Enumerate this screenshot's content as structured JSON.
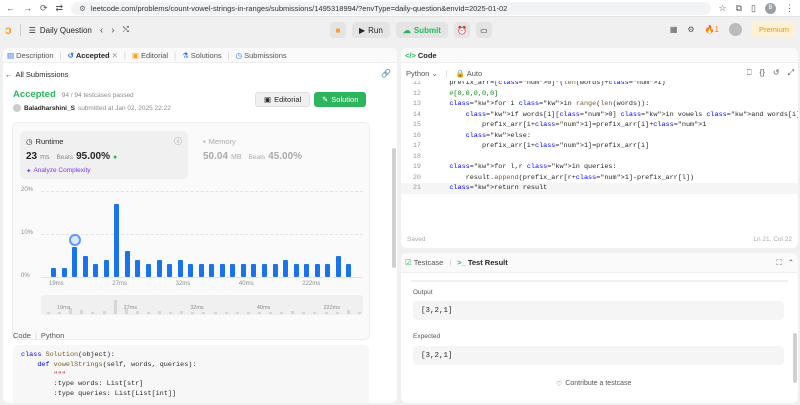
{
  "browser": {
    "url": "leetcode.com/problems/count-vowel-strings-in-ranges/submissions/1495318994/?envType=daily-question&envId=2025-01-02",
    "profile": "B"
  },
  "topbar": {
    "daily_label": "Daily Question",
    "run_label": "Run",
    "submit_label": "Submit",
    "streak": "1",
    "premium_label": "Premium"
  },
  "left_tabs": [
    {
      "label": "Description"
    },
    {
      "label": "Accepted"
    },
    {
      "label": "Editorial"
    },
    {
      "label": "Solutions"
    },
    {
      "label": "Submissions"
    }
  ],
  "submission": {
    "back_label": "All Submissions",
    "status": "Accepted",
    "testcases": "94 / 94 testcases passed",
    "user": "Baladharshini_S",
    "submitted": "submitted at Jan 02, 2025 22:22",
    "editorial_label": "Editorial",
    "solution_label": "Solution",
    "runtime_label": "Runtime",
    "runtime_value": "23",
    "runtime_unit": "ms",
    "beats_label": "Beats",
    "runtime_beats": "95.00%",
    "analyze_label": "Analyze Complexity",
    "memory_label": "Memory",
    "memory_value": "50.04",
    "memory_unit": "MB",
    "memory_beats": "45.00%"
  },
  "chart_data": {
    "type": "bar",
    "yticks": [
      "20%",
      "10%",
      "0%"
    ],
    "xticks": [
      "19ms",
      "27ms",
      "32ms",
      "40ms",
      "222ms"
    ],
    "values": [
      2,
      2,
      7,
      5,
      3,
      4,
      17,
      6,
      4,
      3,
      4,
      3,
      4,
      3,
      3,
      3,
      3,
      3,
      3,
      3,
      3,
      3,
      4,
      3,
      3,
      3,
      3,
      5,
      3
    ],
    "highlight_index": 2,
    "ylim": [
      0,
      20
    ]
  },
  "lower_code": {
    "label": "Code",
    "lang": "Python",
    "lines": [
      "class Solution(object):",
      "    def vowelStrings(self, words, queries):",
      "        \"\"\"",
      "        :type words: List[str]",
      "        :type queries: List[List[int]]"
    ]
  },
  "editor": {
    "title": "Code",
    "lang": "Python",
    "mode": "Auto",
    "saved": "Saved",
    "cursor": "Ln 21, Col 22",
    "line_numbers": [
      "11",
      "12",
      "13",
      "14",
      "15",
      "16",
      "17",
      "18",
      "19",
      "20",
      "21"
    ],
    "lines": [
      "    prefix_arr=[0]*(len(words)+1)",
      "    #[0,0,0,0,0]",
      "    for i in range(len(words)):",
      "        if words[i][0] in vowels and words[i][-1] in vowels:",
      "            prefix_arr[i+1]=prefix_arr[i]+1",
      "        else:",
      "            prefix_arr[i+1]=prefix_arr[i]",
      "",
      "    for l,r in queries:",
      "        result.append(prefix_arr[r+1]-prefix_arr[l])",
      "    return result"
    ]
  },
  "testresult": {
    "testcase_tab": "Testcase",
    "result_tab": "Test Result",
    "output_label": "Output",
    "output_value": "[3,2,1]",
    "expected_label": "Expected",
    "expected_value": "[3,2,1]",
    "contribute_label": "Contribute a testcase"
  }
}
